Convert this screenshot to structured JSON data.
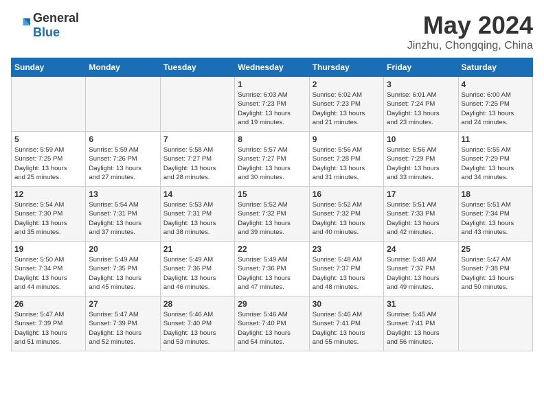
{
  "logo": {
    "general": "General",
    "blue": "Blue"
  },
  "title": "May 2024",
  "subtitle": "Jinzhu, Chongqing, China",
  "days_of_week": [
    "Sunday",
    "Monday",
    "Tuesday",
    "Wednesday",
    "Thursday",
    "Friday",
    "Saturday"
  ],
  "weeks": [
    [
      {
        "day": "",
        "info": ""
      },
      {
        "day": "",
        "info": ""
      },
      {
        "day": "",
        "info": ""
      },
      {
        "day": "1",
        "info": "Sunrise: 6:03 AM\nSunset: 7:23 PM\nDaylight: 13 hours\nand 19 minutes."
      },
      {
        "day": "2",
        "info": "Sunrise: 6:02 AM\nSunset: 7:23 PM\nDaylight: 13 hours\nand 21 minutes."
      },
      {
        "day": "3",
        "info": "Sunrise: 6:01 AM\nSunset: 7:24 PM\nDaylight: 13 hours\nand 23 minutes."
      },
      {
        "day": "4",
        "info": "Sunrise: 6:00 AM\nSunset: 7:25 PM\nDaylight: 13 hours\nand 24 minutes."
      }
    ],
    [
      {
        "day": "5",
        "info": "Sunrise: 5:59 AM\nSunset: 7:25 PM\nDaylight: 13 hours\nand 25 minutes."
      },
      {
        "day": "6",
        "info": "Sunrise: 5:59 AM\nSunset: 7:26 PM\nDaylight: 13 hours\nand 27 minutes."
      },
      {
        "day": "7",
        "info": "Sunrise: 5:58 AM\nSunset: 7:27 PM\nDaylight: 13 hours\nand 28 minutes."
      },
      {
        "day": "8",
        "info": "Sunrise: 5:57 AM\nSunset: 7:27 PM\nDaylight: 13 hours\nand 30 minutes."
      },
      {
        "day": "9",
        "info": "Sunrise: 5:56 AM\nSunset: 7:28 PM\nDaylight: 13 hours\nand 31 minutes."
      },
      {
        "day": "10",
        "info": "Sunrise: 5:56 AM\nSunset: 7:29 PM\nDaylight: 13 hours\nand 33 minutes."
      },
      {
        "day": "11",
        "info": "Sunrise: 5:55 AM\nSunset: 7:29 PM\nDaylight: 13 hours\nand 34 minutes."
      }
    ],
    [
      {
        "day": "12",
        "info": "Sunrise: 5:54 AM\nSunset: 7:30 PM\nDaylight: 13 hours\nand 35 minutes."
      },
      {
        "day": "13",
        "info": "Sunrise: 5:54 AM\nSunset: 7:31 PM\nDaylight: 13 hours\nand 37 minutes."
      },
      {
        "day": "14",
        "info": "Sunrise: 5:53 AM\nSunset: 7:31 PM\nDaylight: 13 hours\nand 38 minutes."
      },
      {
        "day": "15",
        "info": "Sunrise: 5:52 AM\nSunset: 7:32 PM\nDaylight: 13 hours\nand 39 minutes."
      },
      {
        "day": "16",
        "info": "Sunrise: 5:52 AM\nSunset: 7:32 PM\nDaylight: 13 hours\nand 40 minutes."
      },
      {
        "day": "17",
        "info": "Sunrise: 5:51 AM\nSunset: 7:33 PM\nDaylight: 13 hours\nand 42 minutes."
      },
      {
        "day": "18",
        "info": "Sunrise: 5:51 AM\nSunset: 7:34 PM\nDaylight: 13 hours\nand 43 minutes."
      }
    ],
    [
      {
        "day": "19",
        "info": "Sunrise: 5:50 AM\nSunset: 7:34 PM\nDaylight: 13 hours\nand 44 minutes."
      },
      {
        "day": "20",
        "info": "Sunrise: 5:49 AM\nSunset: 7:35 PM\nDaylight: 13 hours\nand 45 minutes."
      },
      {
        "day": "21",
        "info": "Sunrise: 5:49 AM\nSunset: 7:36 PM\nDaylight: 13 hours\nand 46 minutes."
      },
      {
        "day": "22",
        "info": "Sunrise: 5:49 AM\nSunset: 7:36 PM\nDaylight: 13 hours\nand 47 minutes."
      },
      {
        "day": "23",
        "info": "Sunrise: 5:48 AM\nSunset: 7:37 PM\nDaylight: 13 hours\nand 48 minutes."
      },
      {
        "day": "24",
        "info": "Sunrise: 5:48 AM\nSunset: 7:37 PM\nDaylight: 13 hours\nand 49 minutes."
      },
      {
        "day": "25",
        "info": "Sunrise: 5:47 AM\nSunset: 7:38 PM\nDaylight: 13 hours\nand 50 minutes."
      }
    ],
    [
      {
        "day": "26",
        "info": "Sunrise: 5:47 AM\nSunset: 7:39 PM\nDaylight: 13 hours\nand 51 minutes."
      },
      {
        "day": "27",
        "info": "Sunrise: 5:47 AM\nSunset: 7:39 PM\nDaylight: 13 hours\nand 52 minutes."
      },
      {
        "day": "28",
        "info": "Sunrise: 5:46 AM\nSunset: 7:40 PM\nDaylight: 13 hours\nand 53 minutes."
      },
      {
        "day": "29",
        "info": "Sunrise: 5:46 AM\nSunset: 7:40 PM\nDaylight: 13 hours\nand 54 minutes."
      },
      {
        "day": "30",
        "info": "Sunrise: 5:46 AM\nSunset: 7:41 PM\nDaylight: 13 hours\nand 55 minutes."
      },
      {
        "day": "31",
        "info": "Sunrise: 5:45 AM\nSunset: 7:41 PM\nDaylight: 13 hours\nand 56 minutes."
      },
      {
        "day": "",
        "info": ""
      }
    ]
  ]
}
